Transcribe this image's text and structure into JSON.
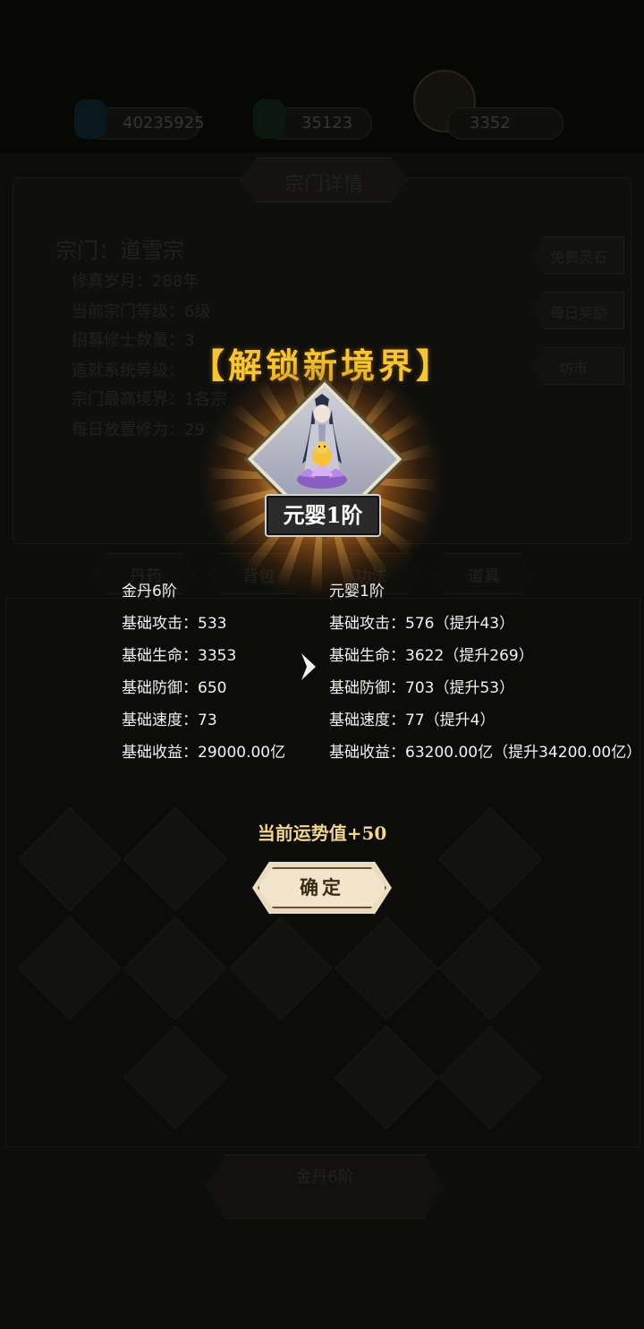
{
  "background": {
    "resources": [
      "40235925",
      "35123",
      "3352"
    ],
    "panel_title": "宗门详情",
    "sect_name": "宗门：道雪宗",
    "info_lines": [
      "修真岁月：288年",
      "当前宗门等级：6级",
      "招募修士数量：3",
      "造就系统等级：",
      "宗门最高境界：1各宗",
      "每日放置修为：29"
    ],
    "side_buttons": [
      "免费灵石",
      "每日奖励",
      "坊市"
    ],
    "tabs": [
      "丹药",
      "背包",
      "功法",
      "道具"
    ],
    "bottom_label": "金丹6阶"
  },
  "modal": {
    "title": "【解锁新境界】",
    "rank_badge": "元婴1阶",
    "left": {
      "header": "金丹6阶",
      "rows": [
        "基础攻击：533",
        "基础生命：3353",
        "基础防御：650",
        "基础速度：73",
        "基础收益：29000.00亿"
      ]
    },
    "right": {
      "header": "元婴1阶",
      "rows": [
        "基础攻击：576（提升43）",
        "基础生命：3622（提升269）",
        "基础防御：703（提升53）",
        "基础速度：77（提升4）",
        "基础收益：63200.00亿（提升34200.00亿）"
      ]
    },
    "fortune": "当前运势值+50",
    "confirm_label": "确定"
  },
  "colors": {
    "title_gold": "#f4c537",
    "fortune_text": "#f1d58e",
    "button_face": "#f1e5cb"
  }
}
